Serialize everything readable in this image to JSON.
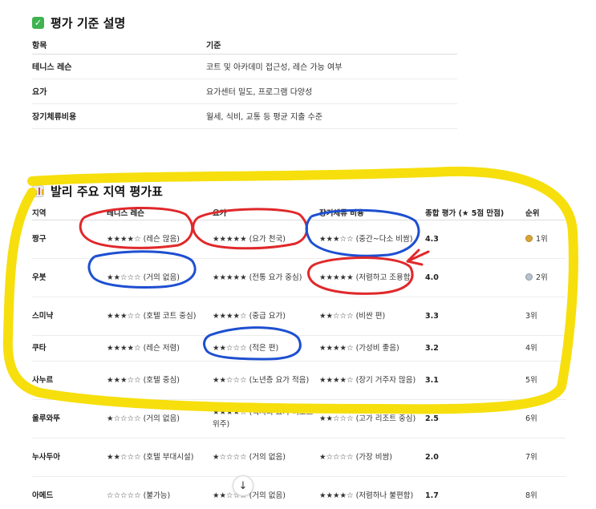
{
  "criteria": {
    "title": "평가 기준 설명",
    "headers": [
      "항목",
      "기준"
    ],
    "rows": [
      {
        "item": "테니스 레슨",
        "desc": "코트 및 아카데미 접근성, 레슨 가능 여부"
      },
      {
        "item": "요가",
        "desc": "요가센터 밀도, 프로그램 다양성"
      },
      {
        "item": "장기체류비용",
        "desc": "월세, 식비, 교통 등 평균 지출 수준"
      }
    ]
  },
  "evaluation": {
    "title": "발리 주요 지역 평가표",
    "headers": [
      "지역",
      "테니스 레슨",
      "요가",
      "장기체류 비용",
      "종합 평가 (★ 5점 만점)",
      "순위"
    ],
    "rows": [
      {
        "region": "짱구",
        "tennis": "★★★★☆ (레슨 많음)",
        "yoga": "★★★★★ (요가 천국)",
        "cost": "★★★☆☆ (중간~다소 비쌈)",
        "score": "4.3",
        "rank": "1위",
        "medal": "gold"
      },
      {
        "region": "우붓",
        "tennis": "★★☆☆☆ (거의 없음)",
        "yoga": "★★★★★ (전통 요가 중심)",
        "cost": "★★★★★ (저렴하고 조용함)",
        "score": "4.0",
        "rank": "2위",
        "medal": "silver"
      },
      {
        "region": "스미냑",
        "tennis": "★★★☆☆ (호텔 코트 중심)",
        "yoga": "★★★★☆ (중급 요가)",
        "cost": "★★☆☆☆ (비싼 편)",
        "score": "3.3",
        "rank": "3위",
        "medal": ""
      },
      {
        "region": "쿠타",
        "tennis": "★★★★☆ (레슨 저렴)",
        "yoga": "★★☆☆☆ (적은 편)",
        "cost": "★★★★☆ (가성비 좋음)",
        "score": "3.2",
        "rank": "4위",
        "medal": ""
      },
      {
        "region": "사누르",
        "tennis": "★★★☆☆ (호텔 중심)",
        "yoga": "★★☆☆☆ (노년층 요가 적음)",
        "cost": "★★★★☆ (장기 거주자 많음)",
        "score": "3.1",
        "rank": "5위",
        "medal": ""
      },
      {
        "region": "울루와뚜",
        "tennis": "★☆☆☆☆ (거의 없음)",
        "yoga": "★★★★☆ (럭셔리 요가 리조트 위주)",
        "cost": "★★☆☆☆ (고가 리조트 중심)",
        "score": "2.5",
        "rank": "6위",
        "medal": ""
      },
      {
        "region": "누사두아",
        "tennis": "★★☆☆☆ (호텔 부대시설)",
        "yoga": "★☆☆☆☆ (거의 없음)",
        "cost": "★☆☆☆☆ (가장 비쌈)",
        "score": "2.0",
        "rank": "7위",
        "medal": ""
      },
      {
        "region": "아메드",
        "tennis": "☆☆☆☆☆ (불가능)",
        "yoga": "★★☆☆☆ (거의 없음)",
        "cost": "★★★★☆ (저렴하나 불편함)",
        "score": "1.7",
        "rank": "8위",
        "medal": ""
      }
    ]
  },
  "colors": {
    "check_icon": "#3eb34f",
    "annotation_red": "#e0282b",
    "annotation_blue": "#1d4fd0",
    "annotation_yellow": "#f6df0c"
  },
  "icons": {
    "title1": "check-mark-icon",
    "title2": "bar-chart-icon",
    "scroll": "arrow-down-icon"
  }
}
